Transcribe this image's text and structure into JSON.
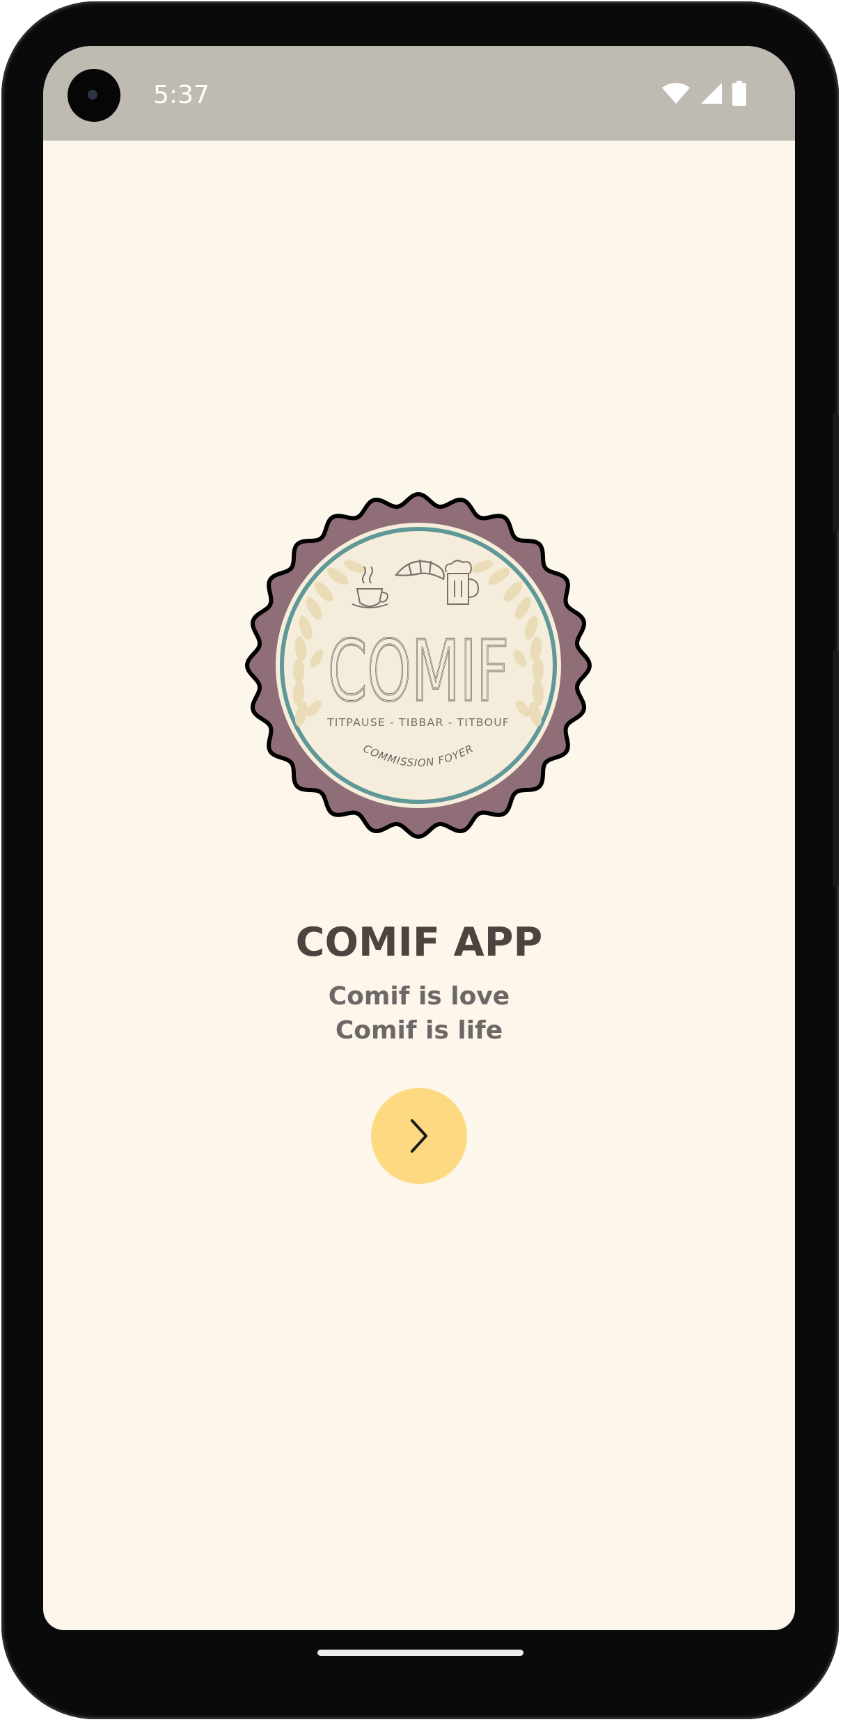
{
  "status_bar": {
    "time": "5:37",
    "icons": [
      "camera-icon",
      "wifi-icon",
      "signal-icon",
      "battery-icon"
    ]
  },
  "logo": {
    "name": "COMIF",
    "subtitle": "TITPAUSE - TIBBAR - TITBOUF",
    "footer": "COMMISSION FOYER",
    "colors": {
      "outer": "#8f6e77",
      "ring": "#5f9898",
      "inner": "#f6eddb"
    }
  },
  "main": {
    "title": "COMIF APP",
    "tagline_1": "Comif is love",
    "tagline_2": "Comif is life",
    "next_button_icon": "chevron-right-icon"
  },
  "colors": {
    "background": "#fcf7ea",
    "status_bar": "#bfbbb3",
    "title": "#4e433f",
    "tagline": "#6e6767",
    "button": "#fdd981"
  }
}
